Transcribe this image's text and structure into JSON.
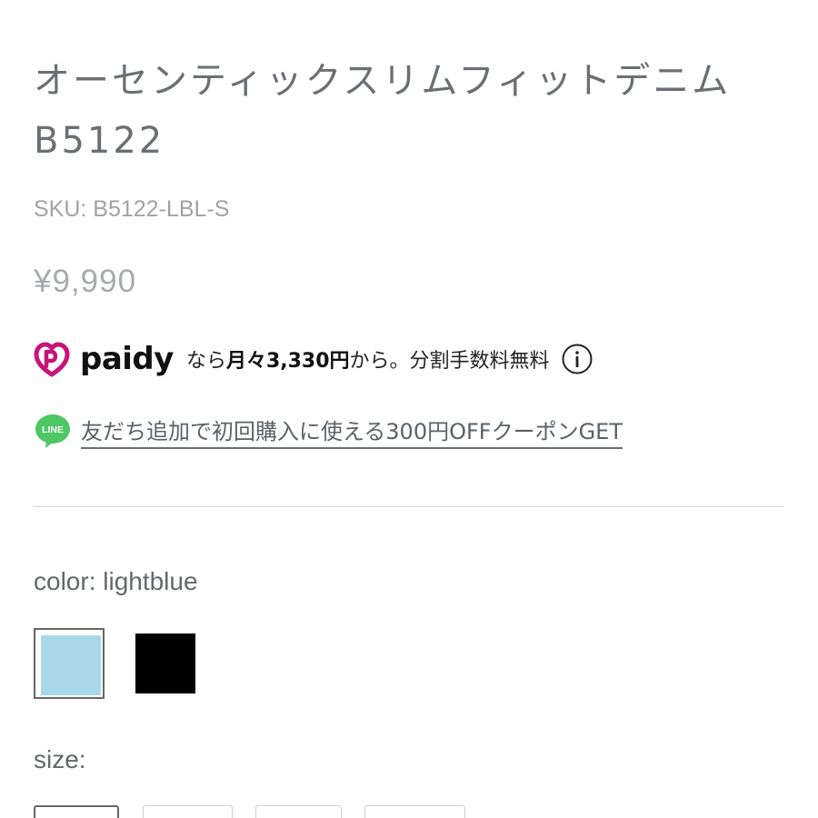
{
  "product": {
    "title": "オーセンティックスリムフィットデニム B5122",
    "sku": "SKU: B5122-LBL-S",
    "price": "¥9,990"
  },
  "paidy": {
    "logo_icon": "paidy-logo-icon",
    "brand": "paidy",
    "text_prefix": "なら",
    "text_bold": "月々3,330円",
    "text_suffix": "から。分割手数料無料",
    "info_icon": "info-icon",
    "brand_color": "#c8137b"
  },
  "line": {
    "icon": "line-icon",
    "icon_text": "LINE",
    "link_text": "友だち追加で初回購入に使える300円OFFクーポンGET",
    "brand_color": "#4cc764"
  },
  "color": {
    "label": "color: lightblue",
    "options": [
      {
        "name": "lightblue",
        "hex": "#a8d8e8",
        "selected": true
      },
      {
        "name": "black",
        "hex": "#000000",
        "selected": false
      }
    ]
  },
  "size": {
    "label": "size:"
  }
}
